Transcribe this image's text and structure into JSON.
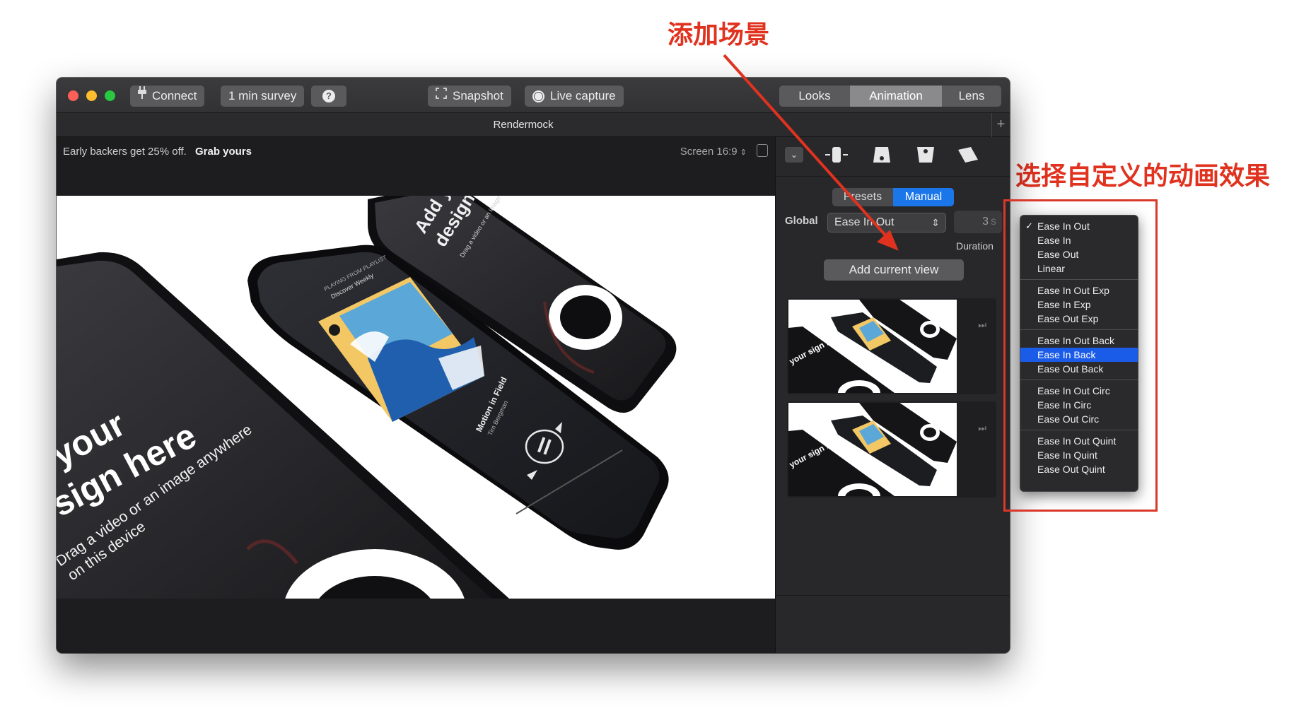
{
  "window": {
    "title": "Rendermock",
    "toolbar": {
      "connect_label": "Connect",
      "survey_label": "1 min survey",
      "help_label": "?",
      "snapshot_label": "Snapshot",
      "live_capture_label": "Live capture"
    },
    "tabs": [
      {
        "label": "Looks",
        "active": false
      },
      {
        "label": "Animation",
        "active": true
      },
      {
        "label": "Lens",
        "active": false
      }
    ],
    "plus_label": "+"
  },
  "viewer": {
    "promo_text": "Early backers get 25% off.",
    "promo_link": "Grab yours",
    "screen_label": "Screen",
    "ratio": "16:9",
    "ratio_chevron": "⌃",
    "mockup_texts": {
      "left_headline_1": "your",
      "left_headline_2": "sign here",
      "left_sub_1": "Drag a video or an image anywhere",
      "left_sub_2": "on this device",
      "right_headline_1": "Add your",
      "right_headline_2": "design here",
      "right_sub": "Drag a video or an image anywhere on this device",
      "track_title": "Motion in Field",
      "track_artist": "Tim Bergman",
      "now_playing_top": "PLAYING FROM PLAYLIST",
      "now_playing_playlist": "Discover Weekly"
    }
  },
  "panel": {
    "presets_label": "Presets",
    "manual_label": "Manual",
    "global_label": "Global",
    "ease_value": "Ease In Out",
    "duration_value": "3",
    "duration_unit": "s",
    "duration_label": "Duration",
    "add_view_label": "Add current view",
    "thumbnails": [
      {
        "thumb_headline": "your sign here"
      },
      {
        "thumb_headline": "your sign here"
      }
    ]
  },
  "easing_menu": {
    "groups": [
      [
        {
          "label": "Ease In Out",
          "checked": true
        },
        {
          "label": "Ease In"
        },
        {
          "label": "Ease Out"
        },
        {
          "label": "Linear"
        }
      ],
      [
        {
          "label": "Ease In Out Exp"
        },
        {
          "label": "Ease In Exp"
        },
        {
          "label": "Ease Out Exp"
        }
      ],
      [
        {
          "label": "Ease In Out Back"
        },
        {
          "label": "Ease In Back",
          "selected": true
        },
        {
          "label": "Ease Out Back"
        }
      ],
      [
        {
          "label": "Ease In Out Circ"
        },
        {
          "label": "Ease In Circ"
        },
        {
          "label": "Ease Out Circ"
        }
      ],
      [
        {
          "label": "Ease In Out Quint"
        },
        {
          "label": "Ease In Quint"
        },
        {
          "label": "Ease Out Quint"
        }
      ]
    ],
    "check_glyph": "✓"
  },
  "annotations": {
    "add_scene": "添加场景",
    "choose_custom": "选择自定义的动画效果"
  },
  "colors": {
    "annotation_red": "#e0321f",
    "accent_blue": "#1b76ea",
    "menu_highlight": "#1a5ce8"
  },
  "icons": {
    "connect": "plug-icon",
    "snapshot": "viewfinder-icon",
    "live_capture": "record-icon",
    "help": "question-icon",
    "next": "skip-forward-icon"
  }
}
